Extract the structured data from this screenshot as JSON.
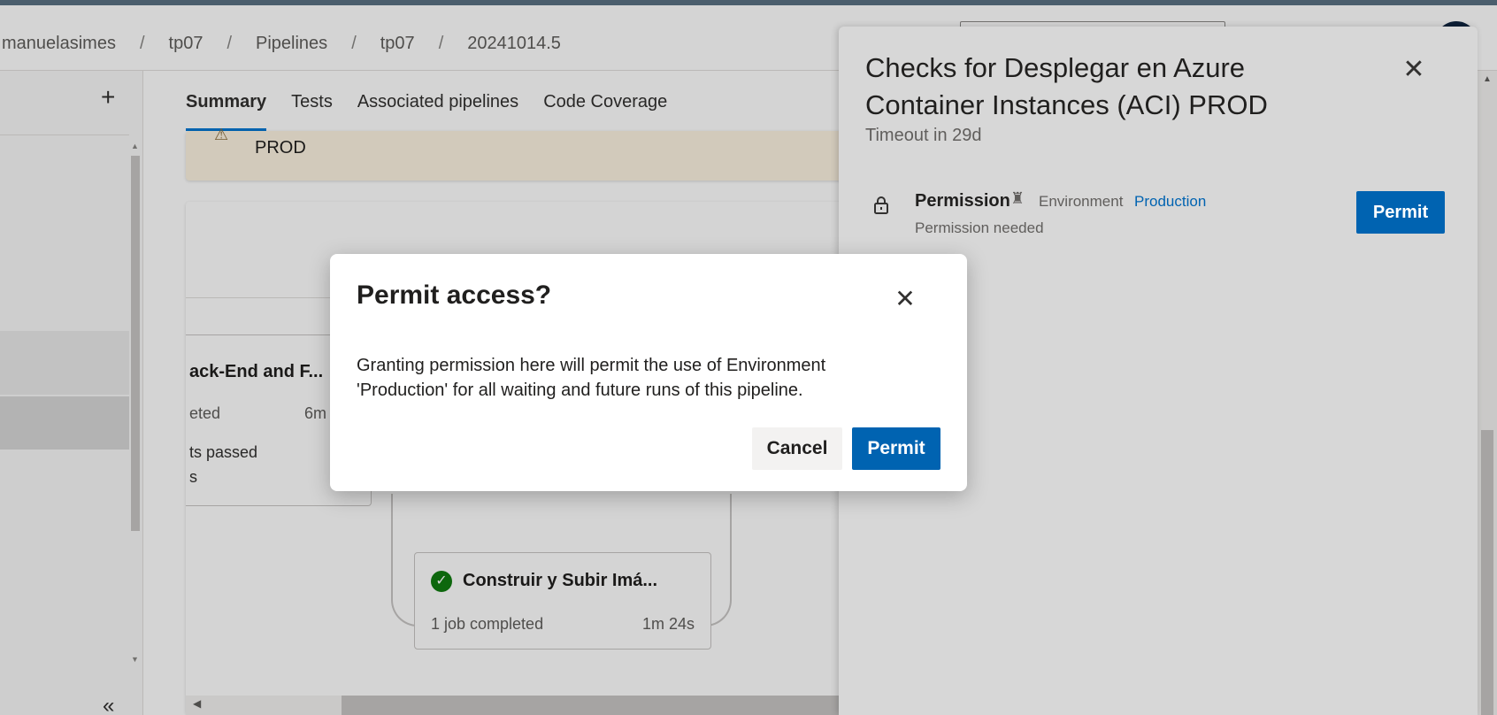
{
  "breadcrumb": [
    {
      "label": "manuelasimes"
    },
    {
      "label": "tp07"
    },
    {
      "label": "Pipelines"
    },
    {
      "label": "tp07"
    },
    {
      "label": "20241014.5"
    }
  ],
  "breadcrumb_separator": "/",
  "leftnav": {
    "add_label": "+",
    "collapse_label": "«"
  },
  "tabs": [
    {
      "label": "Summary",
      "active": true
    },
    {
      "label": "Tests"
    },
    {
      "label": "Associated pipelines"
    },
    {
      "label": "Code Coverage"
    }
  ],
  "banner": {
    "text": "PROD"
  },
  "stages": {
    "left": {
      "title": "ack-End and F...",
      "status": "eted",
      "duration": "6m",
      "tests": "ts passed",
      "extra": "s"
    },
    "build": {
      "title": "Construir y Subir Imá...",
      "status": "1 job completed",
      "duration": "1m 24s"
    }
  },
  "panel": {
    "title": "Checks for Desplegar en Azure Container Instances (ACI) PROD",
    "timeout": "Timeout in 29d",
    "check": {
      "name": "Permission",
      "resource_type": "Environment",
      "resource_name": "Production",
      "status": "Permission needed",
      "button_label": "Permit"
    }
  },
  "dialog": {
    "title": "Permit access?",
    "body": "Granting permission here will permit the use of Environment 'Production' for all waiting and future runs of this pipeline.",
    "cancel_label": "Cancel",
    "permit_label": "Permit"
  },
  "colors": {
    "primary_button": "#0063b1",
    "success": "#107c10",
    "active_tab_underline": "#0078d4"
  }
}
